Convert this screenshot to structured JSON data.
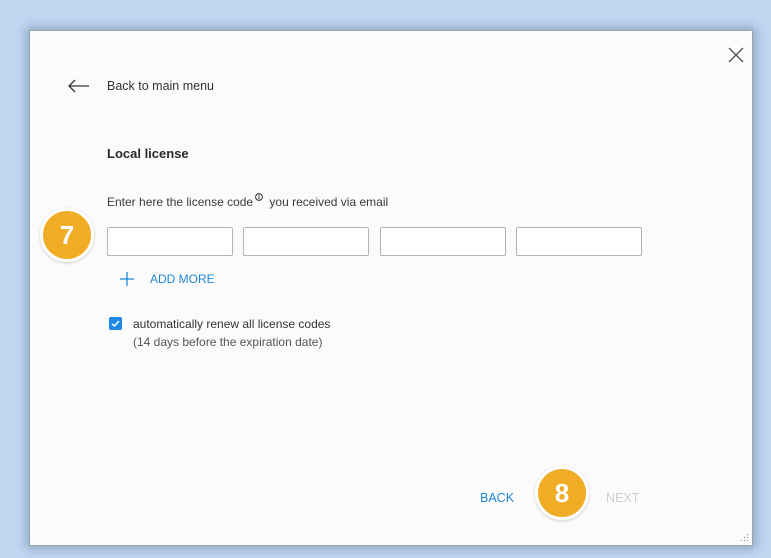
{
  "dialog": {
    "close_icon": "close-icon",
    "back_link": {
      "icon": "arrow-left-icon",
      "label": "Back to main menu"
    },
    "title": "Local license",
    "prompt": {
      "before": "Enter here the license code",
      "info_icon": "info-icon",
      "after": " you received via email"
    },
    "code_inputs": [
      "",
      "",
      "",
      ""
    ],
    "add_more": {
      "icon": "plus-icon",
      "label": "ADD MORE"
    },
    "auto_renew": {
      "checked": true,
      "label": "automatically renew all license codes",
      "note": "(14 days before the expiration date)"
    },
    "footer": {
      "back_label": "BACK",
      "next_label": "NEXT"
    }
  },
  "markers": {
    "step_7": "7",
    "step_8": "8"
  },
  "colors": {
    "accent": "#1e88e5",
    "marker": "#f0ac24",
    "disabled": "#cfcfcf"
  }
}
